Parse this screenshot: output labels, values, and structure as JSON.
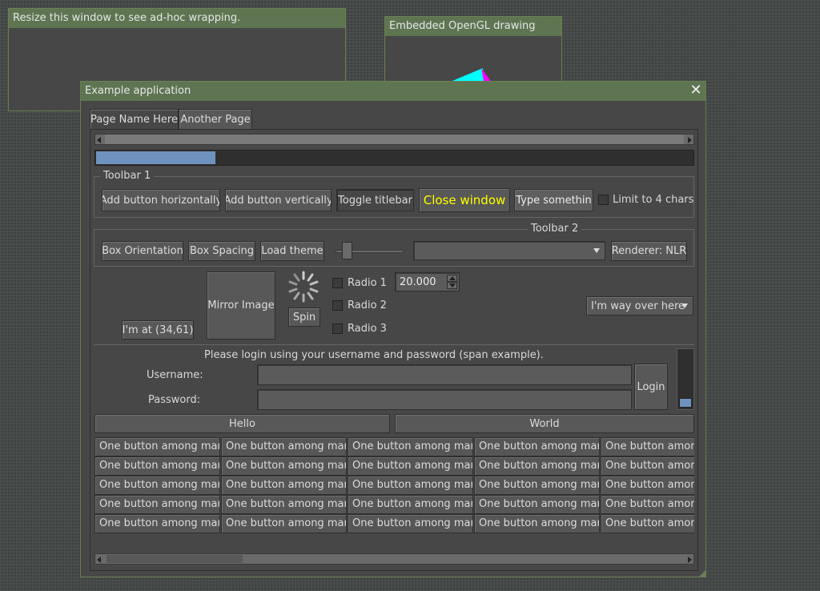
{
  "wrap_window": {
    "title": "Resize this window to see ad-hoc wrapping."
  },
  "opengl_window": {
    "title": "Embedded OpenGL drawing"
  },
  "main_window": {
    "title": "Example application",
    "tabs": [
      {
        "label": "Page Name Here"
      },
      {
        "label": "Another Page"
      }
    ],
    "progress": {
      "value_fraction": 0.2
    },
    "toolbar1": {
      "label": "Toolbar 1",
      "add_horizontal": "Add button horizontally",
      "add_vertical": "Add button vertically",
      "toggle_titlebar": "Toggle titlebar",
      "close_window": "Close window",
      "type_field": "Type somethin",
      "limit_label": "Limit to 4 chars"
    },
    "toolbar2": {
      "label": "Toolbar 2",
      "box_orientation": "Box Orientation",
      "box_spacing": "Box Spacing",
      "load_theme": "Load theme",
      "slider_value_fraction": 0.1,
      "renderer": "Renderer: NLR"
    },
    "misc": {
      "position_button": "I'm at (34,61)",
      "mirror_image": "Mirror Image",
      "spin": "Spin",
      "radios": [
        {
          "label": "Radio 1"
        },
        {
          "label": "Radio 2"
        },
        {
          "label": "Radio 3"
        }
      ],
      "spinbox_value": "20.000",
      "far_dropdown": "I'm way over here"
    },
    "login": {
      "instruction": "Please login using your username and password (span example).",
      "username_label": "Username:",
      "password_label": "Password:",
      "login_button": "Login",
      "vertical_slider_fraction": 0.0
    },
    "split_buttons": {
      "hello": "Hello",
      "world": "World"
    },
    "grid": {
      "button_label": "One button among many",
      "rows": 5,
      "cols": 5
    },
    "colors": {
      "accent_green": "#5f7552",
      "progress_blue": "#6f93be",
      "close_yellow": "#ffff00",
      "gl_cyan": "#00ffff",
      "gl_magenta": "#ff00ff"
    }
  }
}
